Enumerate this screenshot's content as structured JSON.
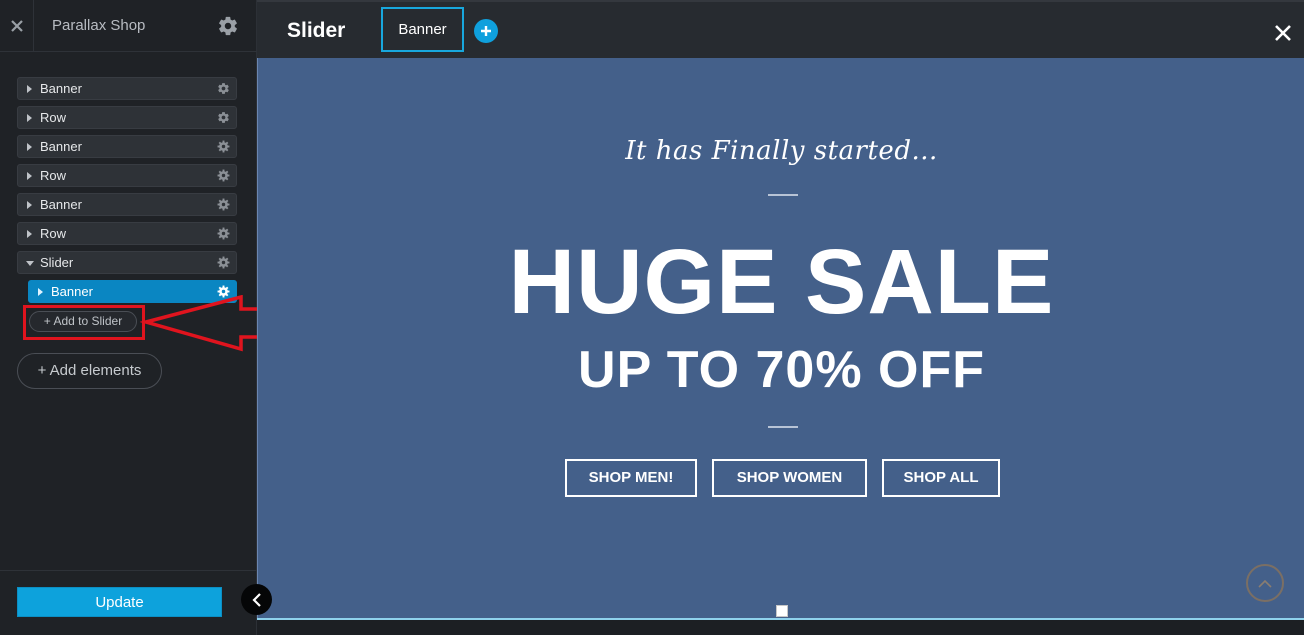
{
  "sidebar": {
    "title": "Parallax Shop",
    "items": [
      {
        "label": "Banner"
      },
      {
        "label": "Row"
      },
      {
        "label": "Banner"
      },
      {
        "label": "Row"
      },
      {
        "label": "Banner"
      },
      {
        "label": "Row"
      },
      {
        "label": "Slider"
      }
    ],
    "child": {
      "label": "Banner"
    },
    "add_to_slider": "+ Add to Slider",
    "add_elements": "+ Add elements",
    "update": "Update"
  },
  "topbar": {
    "title": "Slider",
    "tab": "Banner"
  },
  "banner": {
    "tagline": "It has Finally started...",
    "headline": "HUGE SALE",
    "subheadline": "UP TO 70% OFF",
    "buttons": [
      "SHOP MEN!",
      "SHOP WOMEN",
      "SHOP ALL"
    ]
  },
  "colors": {
    "accent": "#0da2dc",
    "highlight": "#e0141e",
    "banner_bg": "#44608a"
  }
}
